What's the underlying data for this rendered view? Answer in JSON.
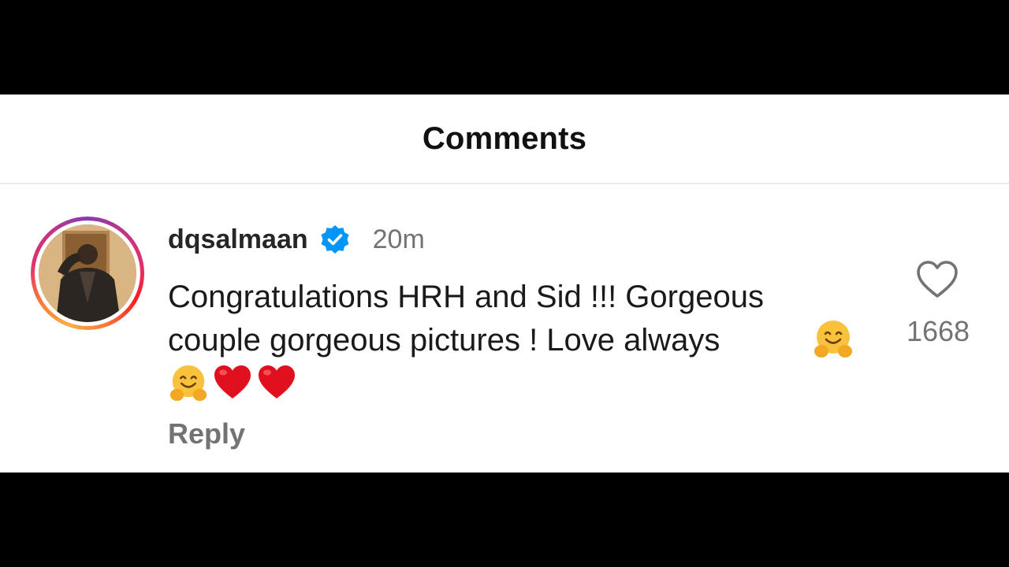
{
  "header": {
    "title": "Comments"
  },
  "comment": {
    "username": "dqsalmaan",
    "verified": true,
    "timestamp": "20m",
    "text": "Congratulations HRH and Sid !!! Gorgeous\ncouple gorgeous pictures ! Love always",
    "trailing_emojis": [
      "hugging-face",
      "hugging-face",
      "red-heart",
      "red-heart"
    ],
    "reply_label": "Reply",
    "like_icon": "heart-outline-icon",
    "like_count": "1668"
  },
  "colors": {
    "verified_blue": "#0095f6",
    "heart_red": "#e0101e",
    "muted_text": "#737373",
    "divider": "#ececec"
  }
}
